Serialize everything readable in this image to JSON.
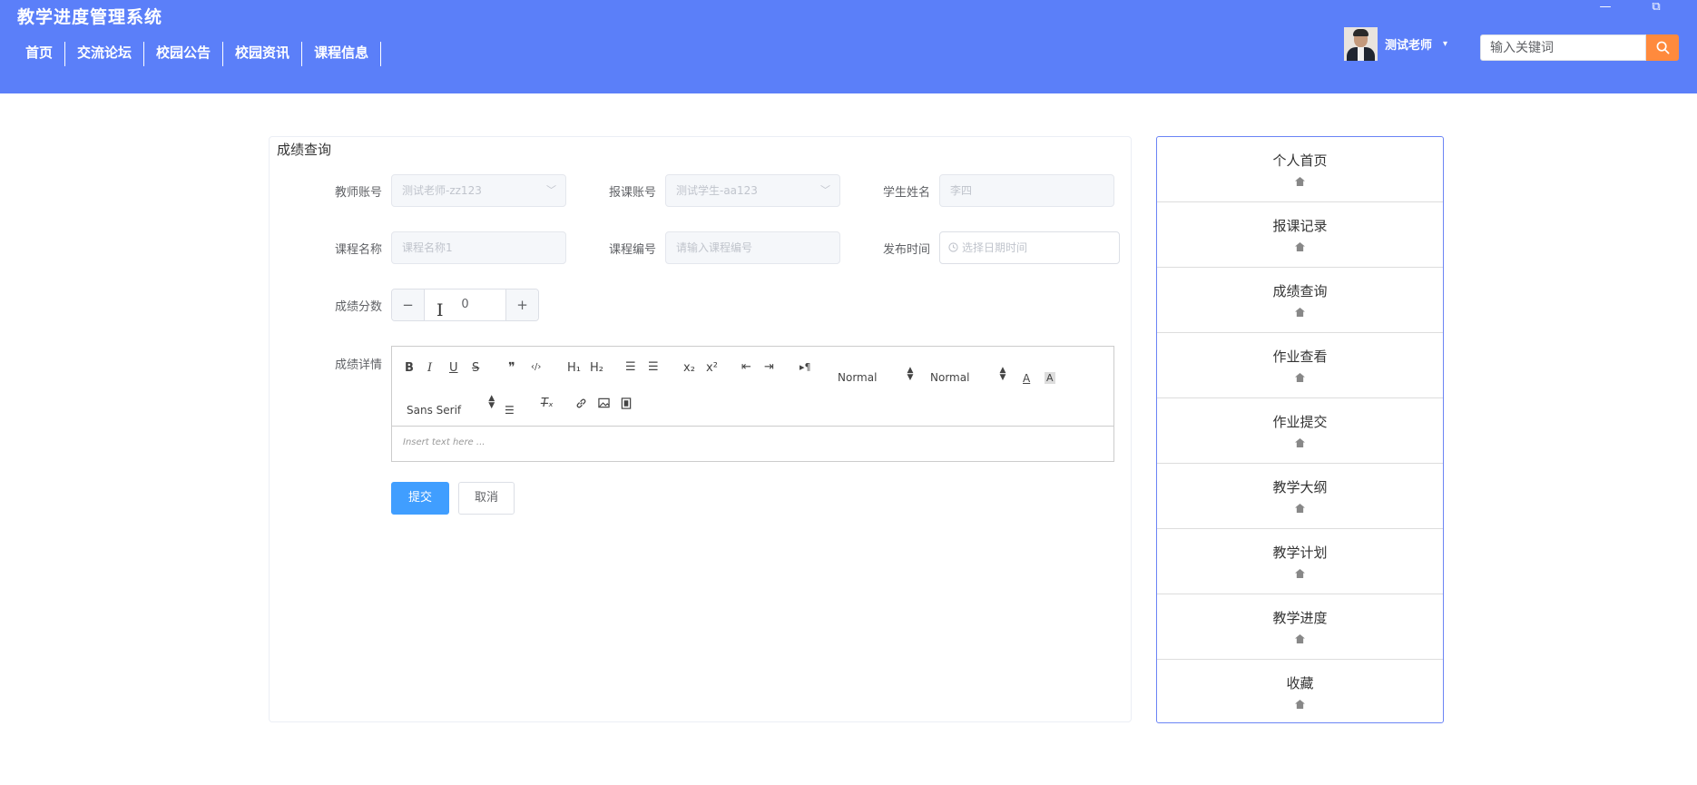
{
  "app": {
    "title": "教学进度管理系统"
  },
  "window": {
    "minimize": "—",
    "restore": "⧉"
  },
  "nav": [
    "首页",
    "交流论坛",
    "校园公告",
    "校园资讯",
    "课程信息"
  ],
  "user": {
    "name": "测试老师",
    "caret": "▾"
  },
  "search": {
    "placeholder": "输入关键词"
  },
  "form": {
    "title": "成绩查询",
    "teacher_account": {
      "label": "教师账号",
      "value": "测试老师-zz123"
    },
    "student_account": {
      "label": "报课账号",
      "value": "测试学生-aa123"
    },
    "student_name": {
      "label": "学生姓名",
      "value": "李四"
    },
    "course_name": {
      "label": "课程名称",
      "value": "课程名称1"
    },
    "course_code": {
      "label": "课程编号",
      "placeholder": "请输入课程编号"
    },
    "publish_time": {
      "label": "发布时间",
      "placeholder": "选择日期时间"
    },
    "score": {
      "label": "成绩分数",
      "value": "0",
      "minus": "−",
      "plus": "+"
    },
    "details": {
      "label": "成绩详情",
      "placeholder": "Insert text here ..."
    },
    "submit": "提交",
    "cancel": "取消"
  },
  "editor_toolbar": {
    "bold": "B",
    "italic": "I",
    "underline": "U",
    "strike": "S",
    "quote": "❞",
    "code": "‹/›",
    "h1": "H₁",
    "h2": "H₂",
    "ordered": "☰",
    "bullet": "☰",
    "sub": "x₂",
    "sup": "x²",
    "outdent": "⇤",
    "indent": "⇥",
    "direction": "▸¶",
    "size": "Normal",
    "header": "Normal",
    "font": "Sans Serif",
    "clean": "T̶ₓ"
  },
  "side_menu": [
    "个人首页",
    "报课记录",
    "成绩查询",
    "作业查看",
    "作业提交",
    "教学大纲",
    "教学计划",
    "教学进度",
    "收藏"
  ],
  "colors": {
    "header": "#5b7ff9",
    "primary": "#409eff",
    "search_button": "#ff8a3d",
    "side_border": "#6b84f5"
  }
}
